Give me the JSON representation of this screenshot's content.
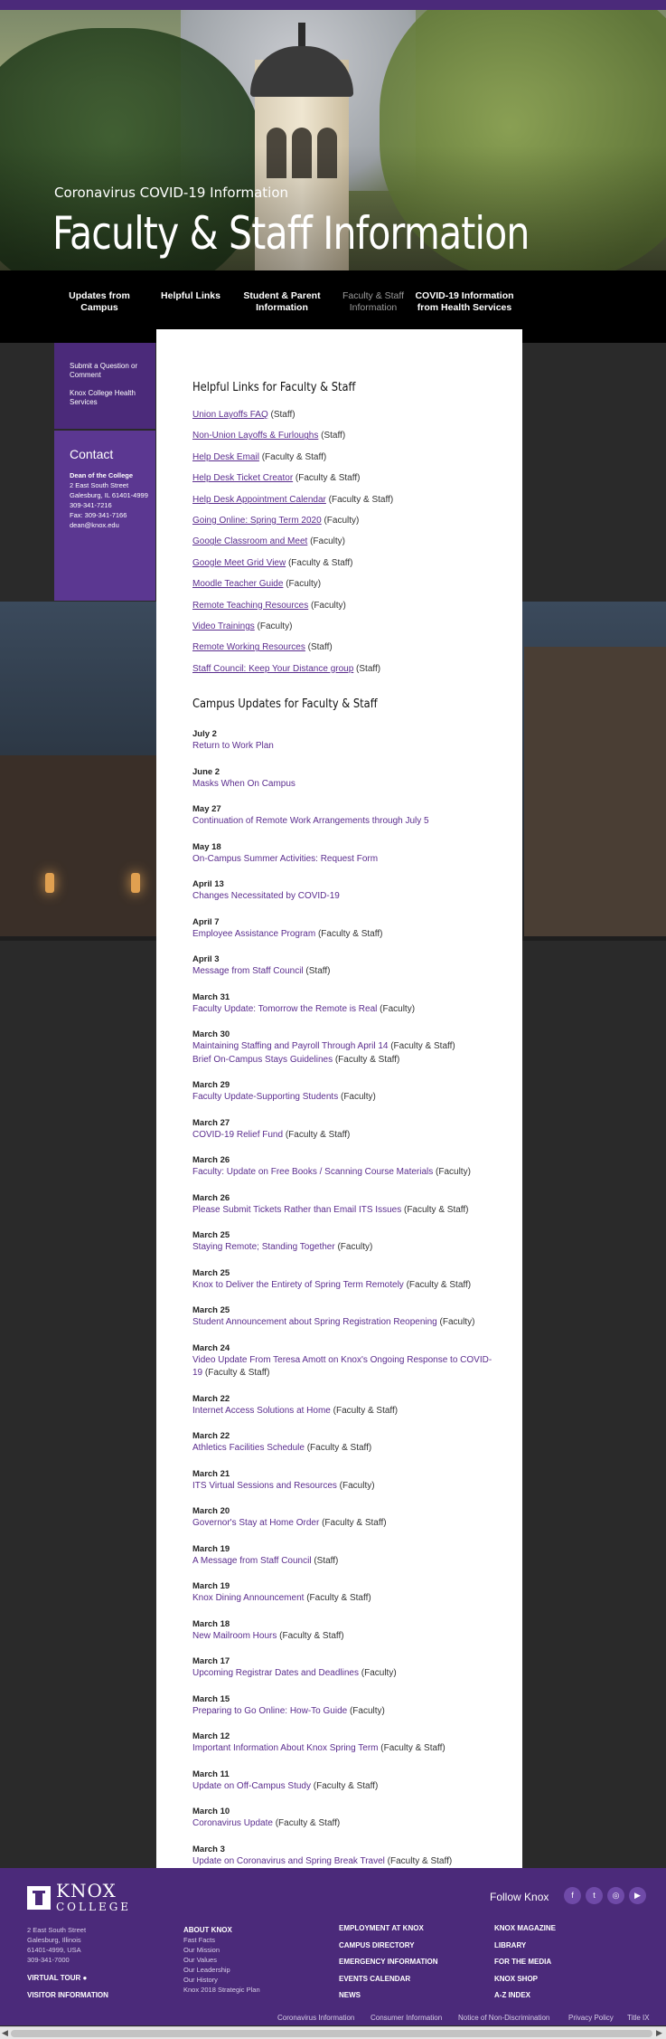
{
  "hero": {
    "kicker": "Coronavirus COVID-19 Information",
    "title": "Faculty & Staff Information"
  },
  "nav": [
    {
      "label": "Updates from Campus"
    },
    {
      "label": "Helpful Links"
    },
    {
      "label": "Student & Parent Information"
    },
    {
      "label": "Faculty & Staff Information"
    },
    {
      "label": "COVID-19 Information from Health Services"
    }
  ],
  "sidebar": {
    "links": [
      "Submit a Question or Comment",
      "Knox College Health Services"
    ],
    "contact": {
      "heading": "Contact",
      "name": "Dean of the College",
      "lines": [
        "2 East South Street",
        "Galesburg, IL 61401-4999",
        "309-341-7216",
        "Fax: 309-341-7166",
        "dean@knox.edu"
      ]
    }
  },
  "helpful": {
    "heading": "Helpful Links for Faculty & Staff",
    "items": [
      {
        "link": "Union Layoffs FAQ",
        "note": " (Staff)"
      },
      {
        "link": "Non-Union Layoffs & Furloughs",
        "note": " (Staff)"
      },
      {
        "link": "Help Desk Email",
        "note": " (Faculty & Staff)"
      },
      {
        "link": "Help Desk Ticket Creator",
        "note": " (Faculty & Staff)"
      },
      {
        "link": "Help Desk Appointment Calendar",
        "note": " (Faculty & Staff)"
      },
      {
        "link": "Going Online: Spring Term 2020",
        "note": " (Faculty)"
      },
      {
        "link": "Google Classroom and Meet",
        "note": " (Faculty)"
      },
      {
        "link": "Google Meet Grid View",
        "note": " (Faculty & Staff)"
      },
      {
        "link": "Moodle Teacher Guide",
        "note": " (Faculty)"
      },
      {
        "link": "Remote Teaching Resources",
        "note": " (Faculty)"
      },
      {
        "link": "Video Trainings",
        "note": " (Faculty)"
      },
      {
        "link": "Remote Working Resources",
        "note": " (Staff)"
      },
      {
        "link": "Staff Council: Keep Your Distance group",
        "note": " (Staff)"
      }
    ]
  },
  "updates": {
    "heading": "Campus Updates for Faculty & Staff",
    "items": [
      {
        "date": "July 2",
        "lines": [
          {
            "link": "Return to Work Plan",
            "note": ""
          }
        ]
      },
      {
        "date": "June 2",
        "lines": [
          {
            "link": "Masks When On Campus",
            "note": ""
          }
        ]
      },
      {
        "date": "May 27",
        "lines": [
          {
            "link": "Continuation of Remote Work Arrangements through July 5",
            "note": ""
          }
        ]
      },
      {
        "date": "May 18",
        "lines": [
          {
            "link": "On-Campus Summer Activities: Request Form",
            "note": ""
          }
        ]
      },
      {
        "date": "April 13",
        "lines": [
          {
            "link": "Changes Necessitated by COVID-19",
            "note": ""
          }
        ]
      },
      {
        "date": "April 7",
        "lines": [
          {
            "link": "Employee Assistance Program",
            "note": " (Faculty & Staff)"
          }
        ]
      },
      {
        "date": "April 3",
        "lines": [
          {
            "link": "Message from Staff Council",
            "note": " (Staff)"
          }
        ]
      },
      {
        "date": "March 31",
        "lines": [
          {
            "link": "Faculty Update: Tomorrow the Remote is Real",
            "note": " (Faculty)"
          }
        ]
      },
      {
        "date": "March 30",
        "lines": [
          {
            "link": "Maintaining Staffing and Payroll Through April 14",
            "note": " (Faculty & Staff)"
          },
          {
            "link": "Brief On-Campus Stays Guidelines",
            "note": " (Faculty & Staff)"
          }
        ]
      },
      {
        "date": "March 29",
        "lines": [
          {
            "link": "Faculty Update-Supporting Students",
            "note": " (Faculty)"
          }
        ]
      },
      {
        "date": "March 27",
        "lines": [
          {
            "link": "COVID-19 Relief Fund",
            "note": " (Faculty & Staff)"
          }
        ]
      },
      {
        "date": "March 26",
        "lines": [
          {
            "link": "Faculty: Update on Free Books / Scanning Course Materials",
            "note": " (Faculty)"
          }
        ]
      },
      {
        "date": "March 26",
        "lines": [
          {
            "link": "Please Submit Tickets Rather than Email ITS Issues",
            "note": " (Faculty & Staff)"
          }
        ]
      },
      {
        "date": "March 25",
        "lines": [
          {
            "link": "Staying Remote; Standing Together",
            "note": " (Faculty)"
          }
        ]
      },
      {
        "date": "March 25",
        "lines": [
          {
            "link": "Knox to Deliver the Entirety of Spring Term Remotely",
            "note": " (Faculty & Staff)"
          }
        ]
      },
      {
        "date": "March 25",
        "lines": [
          {
            "link": "Student Announcement about Spring Registration Reopening",
            "note": " (Faculty)"
          }
        ]
      },
      {
        "date": "March 24",
        "lines": [
          {
            "link": "Video Update From Teresa Amott on Knox's Ongoing Response to COVID-19",
            "note": " (Faculty & Staff)"
          }
        ]
      },
      {
        "date": "March 22",
        "lines": [
          {
            "link": "Internet Access Solutions at Home",
            "note": " (Faculty & Staff)"
          }
        ]
      },
      {
        "date": "March 22",
        "lines": [
          {
            "link": "Athletics Facilities Schedule",
            "note": " (Faculty & Staff)"
          }
        ]
      },
      {
        "date": "March 21",
        "lines": [
          {
            "link": "ITS Virtual Sessions and Resources",
            "note": " (Faculty)"
          }
        ]
      },
      {
        "date": "March 20",
        "lines": [
          {
            "link": "Governor's Stay at Home Order",
            "note": " (Faculty & Staff)"
          }
        ]
      },
      {
        "date": "March 19",
        "lines": [
          {
            "link": "A Message from Staff Council",
            "note": " (Staff)"
          }
        ]
      },
      {
        "date": "March 19",
        "lines": [
          {
            "link": "Knox Dining Announcement",
            "note": " (Faculty & Staff)"
          }
        ]
      },
      {
        "date": "March 18",
        "lines": [
          {
            "link": "New Mailroom Hours",
            "note": " (Faculty & Staff)"
          }
        ]
      },
      {
        "date": "March 17",
        "lines": [
          {
            "link": "Upcoming Registrar Dates and Deadlines",
            "note": " (Faculty)"
          }
        ]
      },
      {
        "date": "March 15",
        "lines": [
          {
            "link": "Preparing to Go Online: How-To Guide",
            "note": " (Faculty)"
          }
        ]
      },
      {
        "date": "March 12",
        "lines": [
          {
            "link": "Important Information About Knox Spring Term",
            "note": " (Faculty & Staff)"
          }
        ]
      },
      {
        "date": "March 11",
        "lines": [
          {
            "link": "Update on Off-Campus Study",
            "note": " (Faculty & Staff)"
          }
        ]
      },
      {
        "date": "March 10",
        "lines": [
          {
            "link": "Coronavirus Update",
            "note": " (Faculty & Staff)"
          }
        ]
      },
      {
        "date": "March 3",
        "lines": [
          {
            "link": "Update on Coronavirus and Spring Break Travel",
            "note": " (Faculty & Staff)"
          }
        ]
      }
    ]
  },
  "footer": {
    "logo_top": "KNOX",
    "logo_bottom": "COLLEGE",
    "follow": "Follow Knox",
    "social": [
      {
        "icon": "facebook-icon",
        "glyph": "f"
      },
      {
        "icon": "twitter-icon",
        "glyph": "t"
      },
      {
        "icon": "instagram-icon",
        "glyph": "◎"
      },
      {
        "icon": "youtube-icon",
        "glyph": "▶"
      }
    ],
    "address": [
      "2 East South Street",
      "Galesburg, Illinois",
      "61401-4999, USA",
      "309-341-7000"
    ],
    "virtual_tour": "VIRTUAL TOUR",
    "visitor_info": "VISITOR INFORMATION",
    "about": {
      "heading": "ABOUT KNOX",
      "items": [
        "Fast Facts",
        "Our Mission",
        "Our Values",
        "Our Leadership",
        "Our History",
        "Knox 2018 Strategic Plan"
      ]
    },
    "col3": [
      "EMPLOYMENT AT KNOX",
      "CAMPUS DIRECTORY",
      "EMERGENCY INFORMATION",
      "EVENTS CALENDAR",
      "NEWS"
    ],
    "col4": [
      "KNOX MAGAZINE",
      "LIBRARY",
      "FOR THE MEDIA",
      "KNOX SHOP",
      "A-Z INDEX"
    ],
    "bottom": [
      "Coronavirus Information",
      "Consumer Information",
      "Notice of Non-Discrimination",
      "Privacy Policy",
      "Title IX"
    ]
  },
  "colors": {
    "brand_purple": "#4b2a7a",
    "link": "#5b2d8e"
  }
}
